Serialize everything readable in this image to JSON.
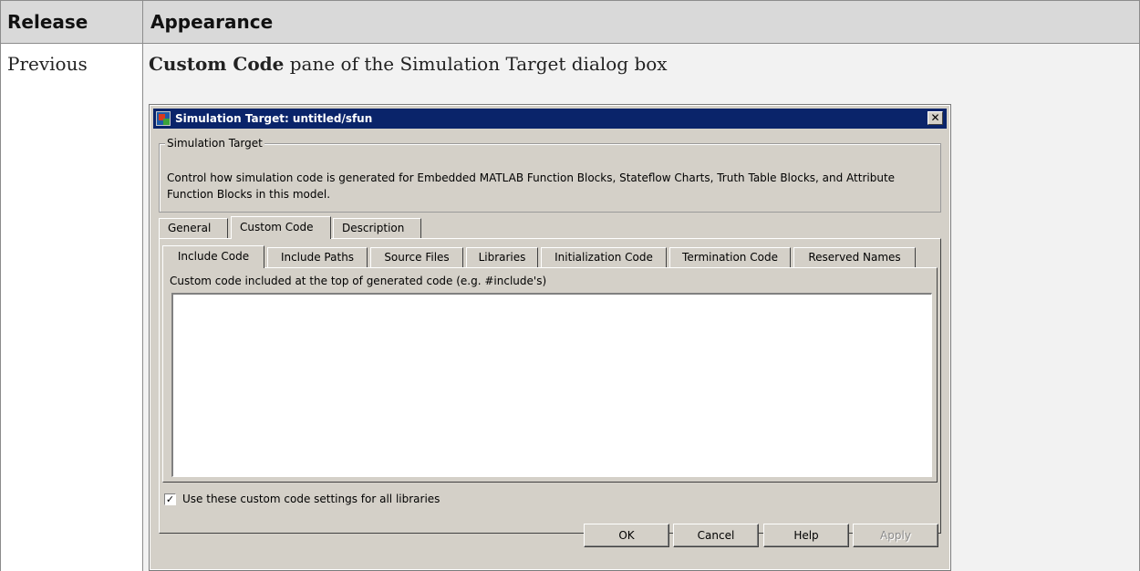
{
  "table": {
    "header_release": "Release",
    "header_appearance": "Appearance",
    "release_value": "Previous",
    "caption_bold": "Custom Code",
    "caption_rest": " pane of the Simulation Target dialog box"
  },
  "dialog": {
    "title": "Simulation Target: untitled/sfun",
    "close_glyph": "✕",
    "group_label": "Simulation Target",
    "description": "Control how simulation code is generated for Embedded MATLAB Function Blocks, Stateflow Charts, Truth Table Blocks, and Attribute Function Blocks in this model.",
    "tabs": [
      {
        "label": "General",
        "active": false
      },
      {
        "label": "Custom Code",
        "active": true
      },
      {
        "label": "Description",
        "active": false
      }
    ],
    "subtabs": [
      {
        "label": "Include Code",
        "active": true
      },
      {
        "label": "Include Paths",
        "active": false
      },
      {
        "label": "Source Files",
        "active": false
      },
      {
        "label": "Libraries",
        "active": false
      },
      {
        "label": "Initialization Code",
        "active": false
      },
      {
        "label": "Termination Code",
        "active": false
      },
      {
        "label": "Reserved Names",
        "active": false
      }
    ],
    "code_label": "Custom code included at the top of generated code (e.g. #include's)",
    "code_value": "",
    "checkbox_checked": true,
    "checkbox_glyph": "✓",
    "checkbox_label": "Use these custom code settings for all libraries",
    "buttons": {
      "ok": "OK",
      "cancel": "Cancel",
      "help": "Help",
      "apply": "Apply"
    },
    "colors": {
      "titlebar": "#0a246a",
      "face": "#d4d0c8",
      "disabled_text": "#8c8c8c"
    }
  }
}
